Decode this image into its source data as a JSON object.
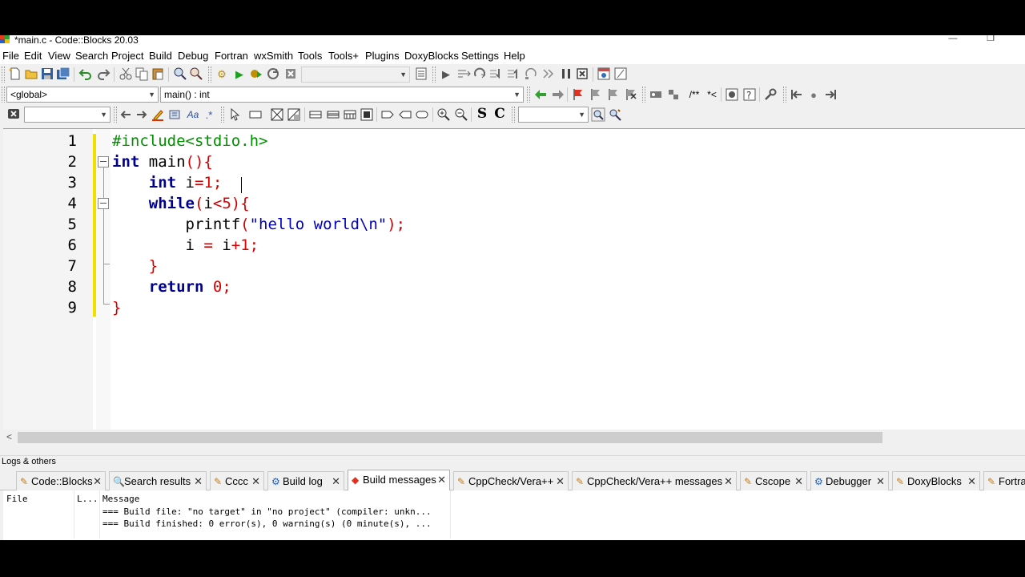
{
  "window": {
    "title": "*main.c - Code::Blocks 20.03",
    "minimize_glyph": "—",
    "maximize_glyph": "❐"
  },
  "menubar": [
    "File",
    "Edit",
    "View",
    "Search",
    "Project",
    "Build",
    "Debug",
    "Fortran",
    "wxSmith",
    "Tools",
    "Tools+",
    "Plugins",
    "DoxyBlocks",
    "Settings",
    "Help"
  ],
  "toolbar2": {
    "scope_value": "<global>",
    "function_value": "main() : int",
    "regex_marker": ".*",
    "comment_marker": "/**",
    "doc_marker": "*<"
  },
  "toolbar3": {
    "search_value": "",
    "find_value": "",
    "s_label": "S",
    "c_label": "C"
  },
  "editor": {
    "line_numbers": [
      "1",
      "2",
      "3",
      "4",
      "5",
      "6",
      "7",
      "8",
      "9"
    ],
    "file_name": "main.c",
    "code_lines": [
      [
        {
          "t": "#include<stdio.h>",
          "c": "pp"
        }
      ],
      [
        {
          "t": "int",
          "c": "kw"
        },
        {
          "t": " main",
          "c": "id"
        },
        {
          "t": "(){",
          "c": "op"
        }
      ],
      [
        {
          "t": "    ",
          "c": "id"
        },
        {
          "t": "int",
          "c": "kw"
        },
        {
          "t": " i",
          "c": "id"
        },
        {
          "t": "=",
          "c": "op"
        },
        {
          "t": "1",
          "c": "num"
        },
        {
          "t": ";",
          "c": "op"
        }
      ],
      [
        {
          "t": "    ",
          "c": "id"
        },
        {
          "t": "while",
          "c": "kw"
        },
        {
          "t": "(",
          "c": "op"
        },
        {
          "t": "i",
          "c": "id"
        },
        {
          "t": "<",
          "c": "op"
        },
        {
          "t": "5",
          "c": "num"
        },
        {
          "t": "){",
          "c": "op"
        }
      ],
      [
        {
          "t": "        printf",
          "c": "id"
        },
        {
          "t": "(",
          "c": "op"
        },
        {
          "t": "\"hello world\\n\"",
          "c": "str"
        },
        {
          "t": ");",
          "c": "op"
        }
      ],
      [
        {
          "t": "        i ",
          "c": "id"
        },
        {
          "t": "=",
          "c": "op"
        },
        {
          "t": " i",
          "c": "id"
        },
        {
          "t": "+",
          "c": "op"
        },
        {
          "t": "1",
          "c": "num"
        },
        {
          "t": ";",
          "c": "op"
        }
      ],
      [
        {
          "t": "    ",
          "c": "id"
        },
        {
          "t": "}",
          "c": "op"
        }
      ],
      [
        {
          "t": "    ",
          "c": "id"
        },
        {
          "t": "return",
          "c": "kw"
        },
        {
          "t": " ",
          "c": "id"
        },
        {
          "t": "0",
          "c": "num"
        },
        {
          "t": ";",
          "c": "op"
        }
      ],
      [
        {
          "t": "}",
          "c": "op"
        }
      ]
    ]
  },
  "logs": {
    "panel_title": "Logs & others",
    "tabs": [
      {
        "label": "Code::Blocks",
        "icon": "page-icon",
        "glyph": "✎"
      },
      {
        "label": "Search results",
        "icon": "search-icon",
        "glyph": "🔍"
      },
      {
        "label": "Cccc",
        "icon": "page-icon",
        "glyph": "✎"
      },
      {
        "label": "Build log",
        "icon": "gear-icon",
        "glyph": "⚙"
      },
      {
        "label": "Build messages",
        "icon": "marker-icon",
        "glyph": "◆"
      },
      {
        "label": "CppCheck/Vera++",
        "icon": "page-icon",
        "glyph": "✎"
      },
      {
        "label": "CppCheck/Vera++ messages",
        "icon": "page-icon",
        "glyph": "✎"
      },
      {
        "label": "Cscope",
        "icon": "page-icon",
        "glyph": "✎"
      },
      {
        "label": "Debugger",
        "icon": "gear-icon",
        "glyph": "⚙"
      },
      {
        "label": "DoxyBlocks",
        "icon": "page-icon",
        "glyph": "✎"
      },
      {
        "label": "Fortra",
        "icon": "page-icon",
        "glyph": "✎"
      }
    ],
    "active_tab": "Build messages",
    "close_glyph": "✕",
    "columns": {
      "file": "File",
      "line": "L...",
      "message": "Message"
    },
    "messages": [
      "=== Build file: \"no target\" in \"no project\" (compiler: unkn...",
      "=== Build finished: 0 error(s), 0 warning(s) (0 minute(s), ..."
    ]
  },
  "colors": {
    "preprocessor": "#009000",
    "keyword": "#00008b",
    "operator": "#d00000",
    "number": "#e00000",
    "string": "#0000c0",
    "change_bar": "#f0e000"
  }
}
